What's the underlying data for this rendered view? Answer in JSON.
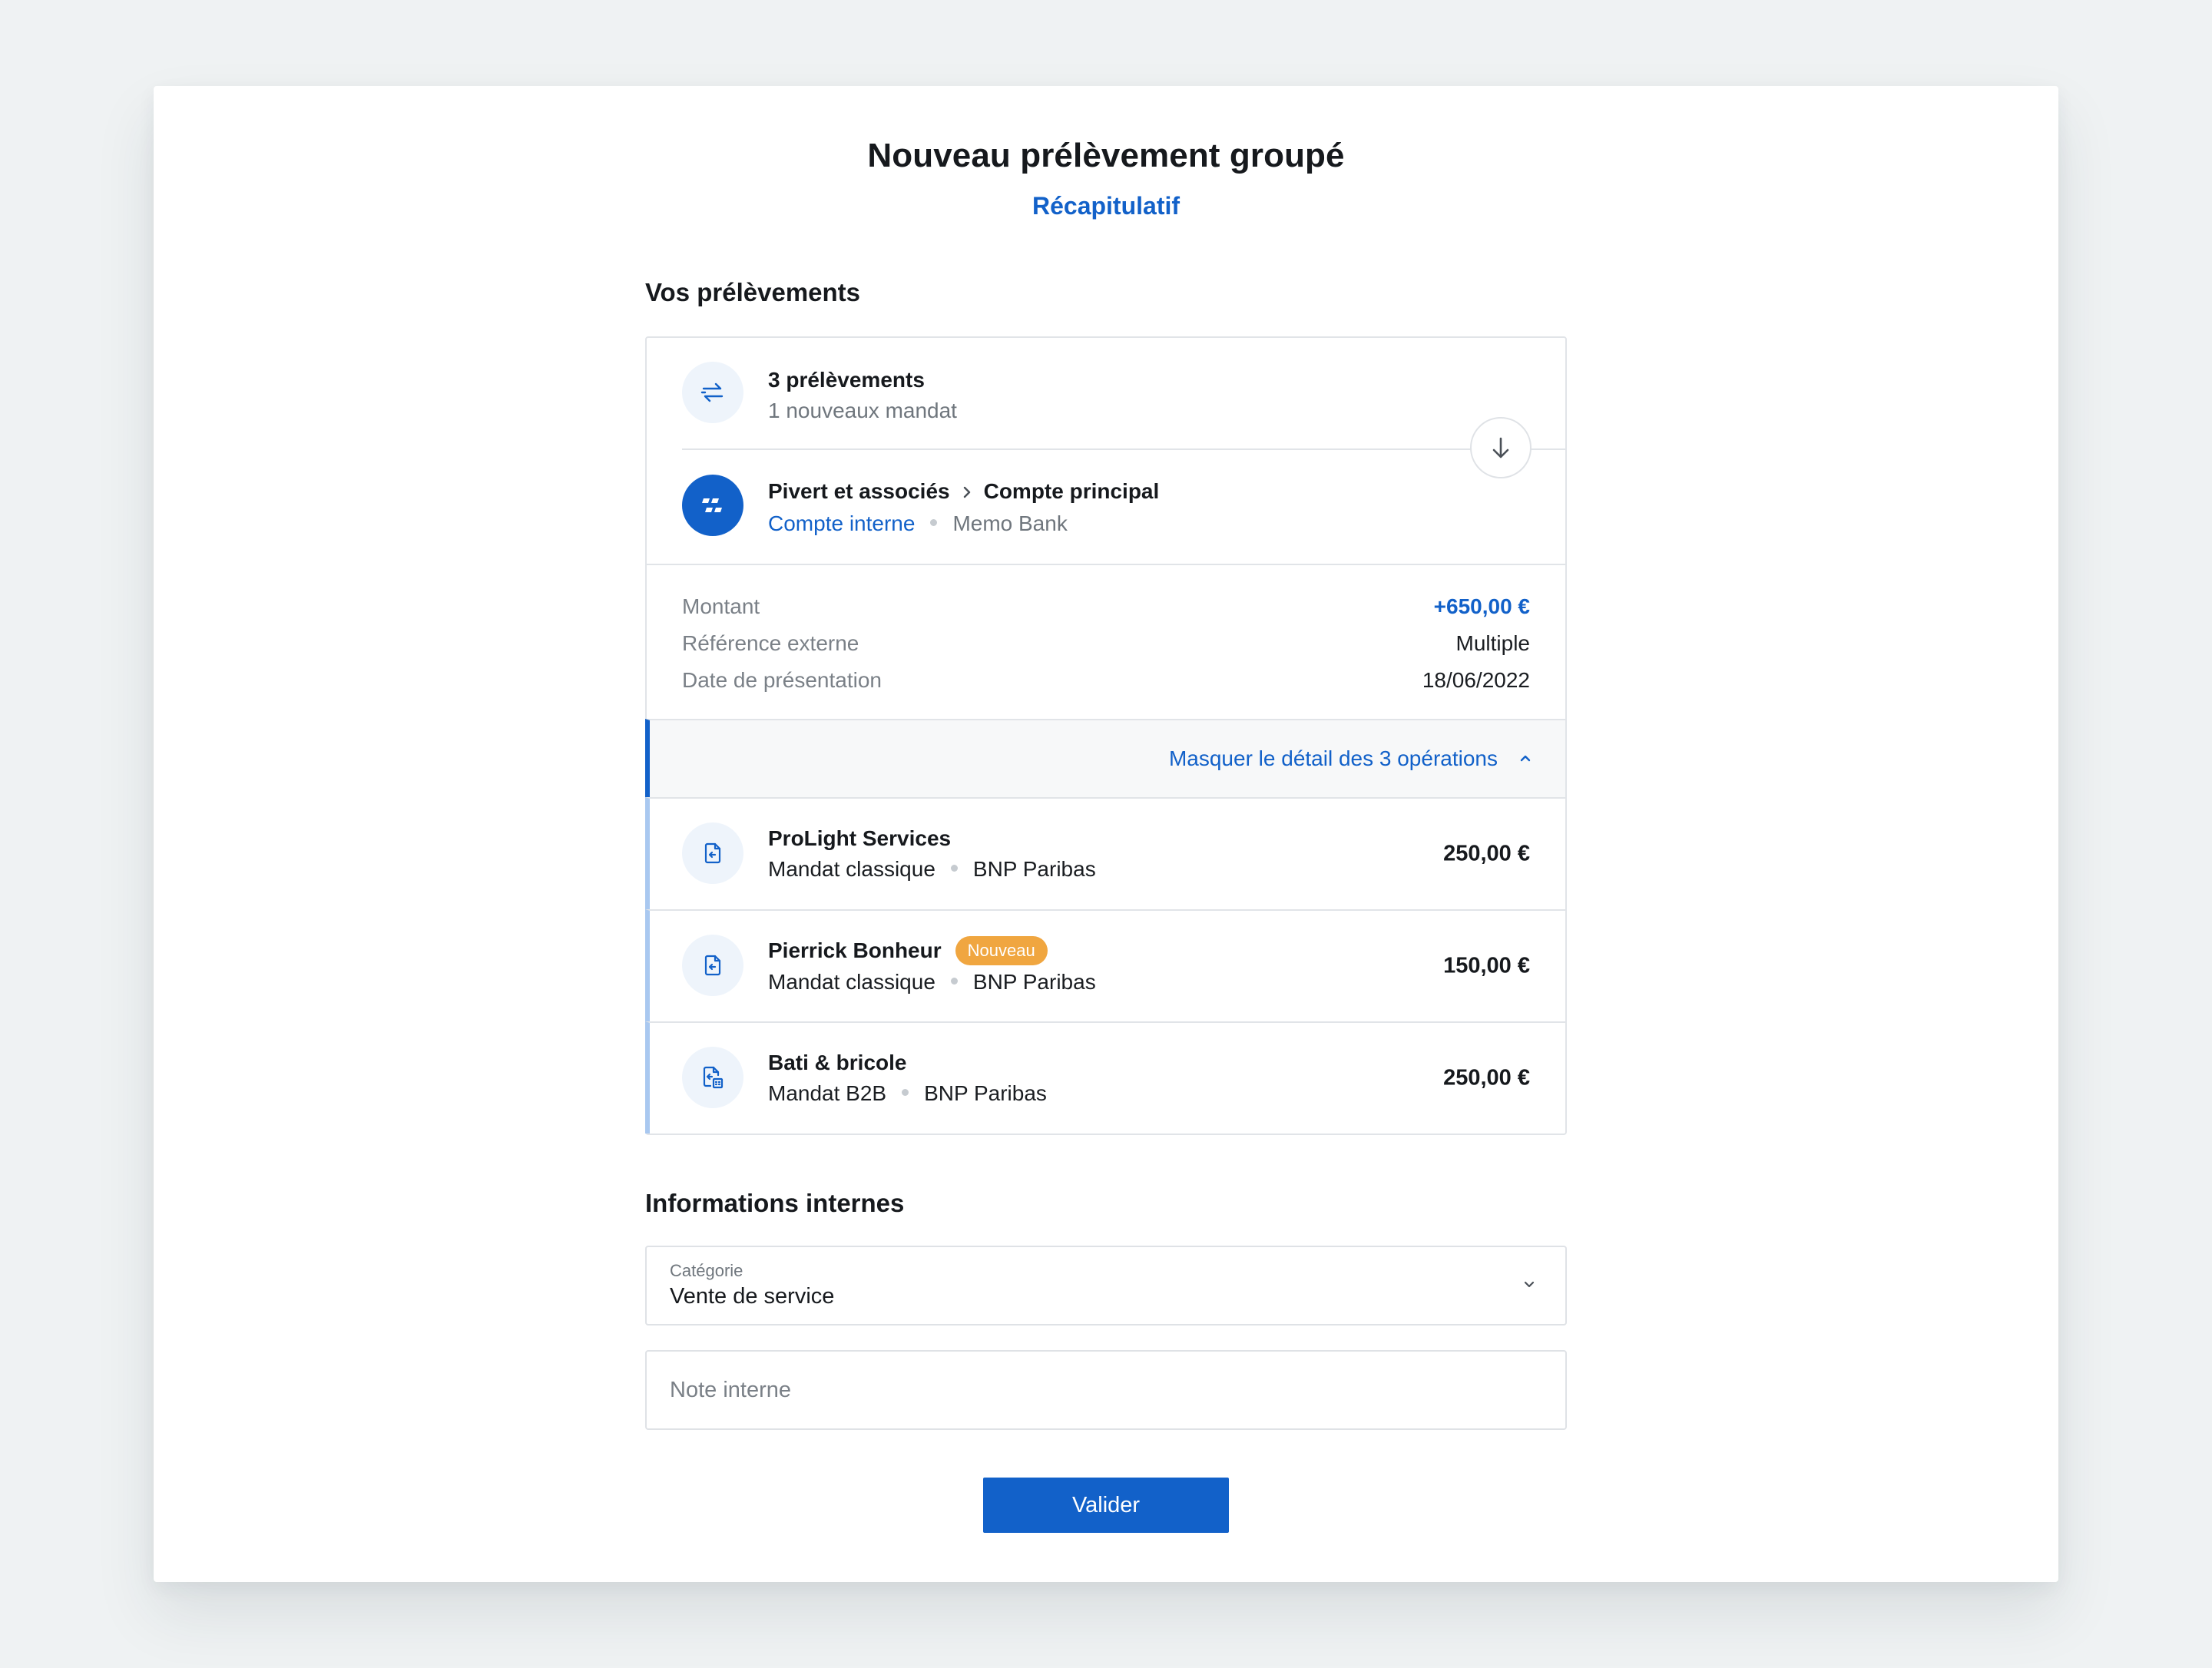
{
  "modal": {
    "title": "Nouveau prélèvement groupé",
    "step": "Récapitulatif"
  },
  "debits": {
    "section_title": "Vos prélèvements",
    "summary": {
      "count_label": "3 prélèvements",
      "mandates_label": "1 nouveaux mandat"
    },
    "source": {
      "company": "Pivert et associés",
      "account": "Compte principal",
      "account_type": "Compte interne",
      "bank": "Memo Bank"
    },
    "details": [
      {
        "label": "Montant",
        "value": "+650,00 €"
      },
      {
        "label": "Référence externe",
        "value": "Multiple"
      },
      {
        "label": "Date de présentation",
        "value": "18/06/2022"
      }
    ],
    "toggle_label": "Masquer le détail des 3 opérations",
    "operations": [
      {
        "name": "ProLight Services",
        "mandate": "Mandat classique",
        "bank": "BNP Paribas",
        "amount": "250,00 €",
        "icon": "document-debit-icon"
      },
      {
        "name": "Pierrick Bonheur",
        "badge": "Nouveau",
        "mandate": "Mandat classique",
        "bank": "BNP Paribas",
        "amount": "150,00 €",
        "icon": "document-debit-icon"
      },
      {
        "name": "Bati & bricole",
        "mandate": "Mandat B2B",
        "bank": "BNP Paribas",
        "amount": "250,00 €",
        "icon": "document-b2b-icon"
      }
    ]
  },
  "internal": {
    "section_title": "Informations internes",
    "category": {
      "label": "Catégorie",
      "value": "Vente de service"
    },
    "note": {
      "placeholder": "Note interne"
    }
  },
  "actions": {
    "submit_label": "Valider"
  },
  "colors": {
    "accent": "#1261c9",
    "badge": "#f0a640",
    "background": "#eff2f3"
  }
}
